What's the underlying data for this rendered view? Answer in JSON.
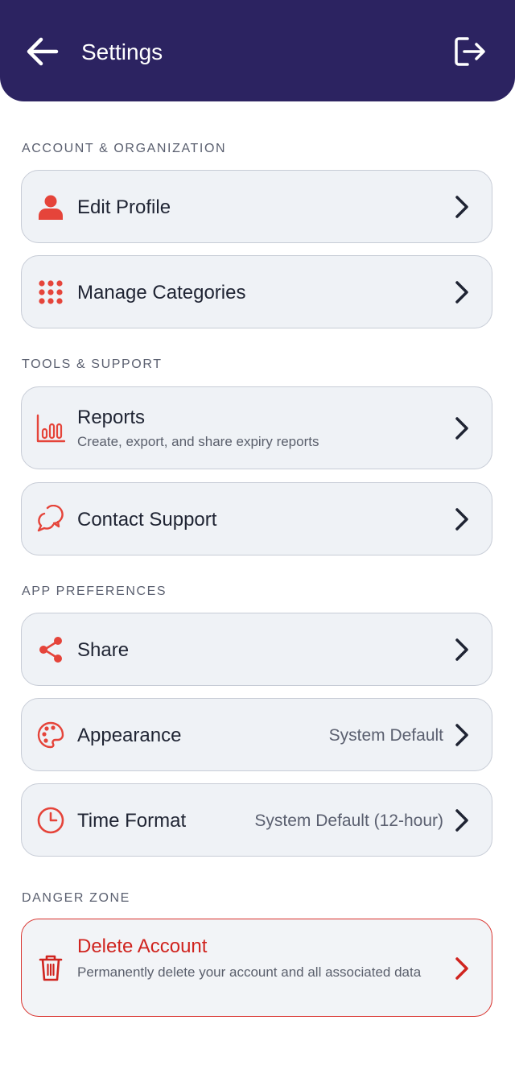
{
  "header": {
    "title": "Settings",
    "back_icon": "arrow-left-icon",
    "logout_icon": "logout-icon",
    "background": "#2c2361"
  },
  "accent_color": "#e5443a",
  "danger_color": "#d0241f",
  "sections": [
    {
      "label": "ACCOUNT & ORGANIZATION",
      "items": [
        {
          "title": "Edit Profile",
          "icon": "person-icon"
        },
        {
          "title": "Manage Categories",
          "icon": "grid-dots-icon"
        }
      ]
    },
    {
      "label": "TOOLS & SUPPORT",
      "items": [
        {
          "title": "Reports",
          "subtitle": "Create, export, and share expiry reports",
          "icon": "bar-chart-icon"
        },
        {
          "title": "Contact Support",
          "icon": "chat-bubbles-icon"
        }
      ]
    },
    {
      "label": "APP PREFERENCES",
      "items": [
        {
          "title": "Share",
          "icon": "share-icon"
        },
        {
          "title": "Appearance",
          "value": "System Default",
          "icon": "palette-icon"
        },
        {
          "title": "Time Format",
          "value": "System Default (12-hour)",
          "icon": "clock-icon"
        }
      ]
    },
    {
      "label": "DANGER ZONE",
      "items": [
        {
          "title": "Delete Account",
          "subtitle": "Permanently delete your account and all associated data",
          "icon": "trash-icon"
        }
      ]
    }
  ]
}
